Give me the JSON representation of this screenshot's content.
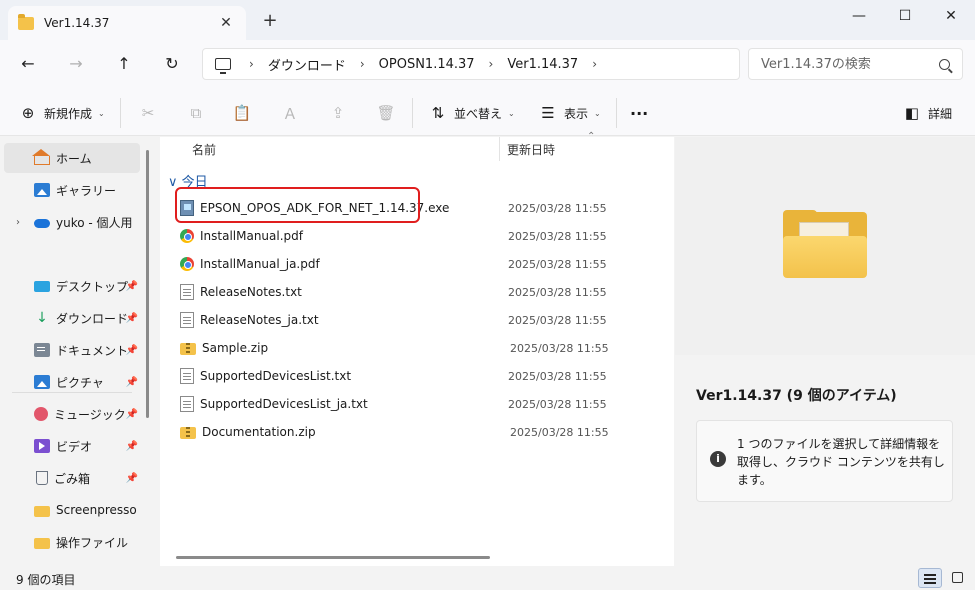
{
  "window": {
    "tab_title": "Ver1.14.37",
    "new_tab": "+",
    "tab_close": "✕",
    "minimize": "—",
    "maximize": "☐",
    "close": "✕"
  },
  "nav": {
    "back": "←",
    "forward": "→",
    "up": "↑",
    "refresh": "↻"
  },
  "breadcrumb": [
    {
      "label": "ダウンロード"
    },
    {
      "label": "OPOSN1.14.37"
    },
    {
      "label": "Ver1.14.37"
    }
  ],
  "breadcrumb_sep": "›",
  "search": {
    "placeholder": "Ver1.14.37の検索"
  },
  "toolbar": {
    "new_label": "新規作成",
    "sort_label": "並べ替え",
    "view_label": "表示",
    "more": "···",
    "details_label": "詳細",
    "chev": "⌄",
    "icons": {
      "new": "⊕",
      "cut": "✂",
      "copy": "⧉",
      "paste": "📋",
      "rename": "Ａ",
      "share": "⇪",
      "delete": "🗑",
      "sort": "⇅",
      "view": "☰",
      "details": "◧"
    }
  },
  "sidebar": {
    "items": [
      {
        "label": "ホーム",
        "icon": "home-icon"
      },
      {
        "label": "ギャラリー",
        "icon": "gallery-icon"
      },
      {
        "label": "yuko - 個人用",
        "icon": "onedrive-icon"
      },
      {
        "label": "デスクトップ",
        "icon": "desktop-icon"
      },
      {
        "label": "ダウンロード",
        "icon": "download-icon"
      },
      {
        "label": "ドキュメント",
        "icon": "documents-icon"
      },
      {
        "label": "ピクチャ",
        "icon": "pictures-icon"
      },
      {
        "label": "ミュージック",
        "icon": "music-icon"
      },
      {
        "label": "ビデオ",
        "icon": "video-icon"
      },
      {
        "label": "ごみ箱",
        "icon": "recycle-bin-icon"
      },
      {
        "label": "Screenpresso",
        "icon": "folder-icon"
      },
      {
        "label": "操作ファイル",
        "icon": "folder-icon"
      }
    ],
    "pin": "📌",
    "expander": "›"
  },
  "filelist": {
    "col_name": "名前",
    "col_date": "更新日時",
    "sort_chev": "⌃",
    "group": "∨ 今日",
    "files": [
      {
        "name": "EPSON_OPOS_ADK_FOR_NET_1.14.37.exe",
        "date": "2025/03/28 11:55",
        "type": "exe"
      },
      {
        "name": "InstallManual.pdf",
        "date": "2025/03/28 11:55",
        "type": "pdf"
      },
      {
        "name": "InstallManual_ja.pdf",
        "date": "2025/03/28 11:55",
        "type": "pdf"
      },
      {
        "name": "ReleaseNotes.txt",
        "date": "2025/03/28 11:55",
        "type": "txt"
      },
      {
        "name": "ReleaseNotes_ja.txt",
        "date": "2025/03/28 11:55",
        "type": "txt"
      },
      {
        "name": "Sample.zip",
        "date": "2025/03/28 11:55",
        "type": "zip"
      },
      {
        "name": "SupportedDevicesList.txt",
        "date": "2025/03/28 11:55",
        "type": "txt"
      },
      {
        "name": "SupportedDevicesList_ja.txt",
        "date": "2025/03/28 11:55",
        "type": "txt"
      },
      {
        "name": "Documentation.zip",
        "date": "2025/03/28 11:55",
        "type": "zip"
      }
    ]
  },
  "preview": {
    "title": "Ver1.14.37 (9 個のアイテム)",
    "info_icon": "i",
    "info_text": "1 つのファイルを選択して詳細情報を取得し、クラウド コンテンツを共有します。"
  },
  "status": {
    "count_text": "9 個の項目"
  },
  "colors": {
    "highlight": "#e01e1e",
    "accent": "#1f5aa6"
  }
}
